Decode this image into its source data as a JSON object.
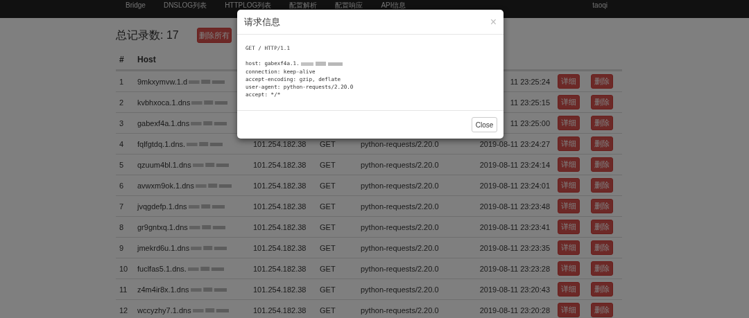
{
  "nav": {
    "items": [
      {
        "label": "Bridge"
      },
      {
        "label": "DNSLOG列表"
      },
      {
        "label": "HTTPLOG列表"
      },
      {
        "label": "配置解析"
      },
      {
        "label": "配置响应"
      },
      {
        "label": "API信息"
      }
    ],
    "user": "taoqi"
  },
  "summary": {
    "title": "总记录数: 17",
    "delete_all": "删除所有"
  },
  "table": {
    "columns": [
      "#",
      "Host"
    ],
    "rows": [
      {
        "index": "1",
        "host": "9mkxymvw.1.d",
        "redacted": true,
        "time": "11 23:25:24",
        "detail": "详细",
        "delete": "删除"
      },
      {
        "index": "2",
        "host": "kvbhxoca.1.dns",
        "redacted": true,
        "time": "11 23:25:15",
        "detail": "详细",
        "delete": "删除"
      },
      {
        "index": "3",
        "host": "gabexf4a.1.dns",
        "redacted": true,
        "time": "11 23:25:00",
        "detail": "详细",
        "delete": "删除"
      },
      {
        "index": "4",
        "host": "fqlfgtdq.1.dns.",
        "redacted": true,
        "ip": "101.254.182.38",
        "method": "GET",
        "agent": "python-requests/2.20.0",
        "time": "2019-08-11 23:24:27",
        "detail": "详细",
        "delete": "删除"
      },
      {
        "index": "5",
        "host": "qzuum4bl.1.dns",
        "redacted": true,
        "ip": "101.254.182.38",
        "method": "GET",
        "agent": "python-requests/2.20.0",
        "time": "2019-08-11 23:24:14",
        "detail": "详细",
        "delete": "删除"
      },
      {
        "index": "6",
        "host": "avwxm9ok.1.dns",
        "redacted": true,
        "ip": "101.254.182.38",
        "method": "GET",
        "agent": "python-requests/2.20.0",
        "time": "2019-08-11 23:24:01",
        "detail": "详细",
        "delete": "删除"
      },
      {
        "index": "7",
        "host": "jvqgdefp.1.dns",
        "redacted": true,
        "ip": "101.254.182.38",
        "method": "GET",
        "agent": "python-requests/2.20.0",
        "time": "2019-08-11 23:23:48",
        "detail": "详细",
        "delete": "删除"
      },
      {
        "index": "8",
        "host": "gr9gntxq.1.dns",
        "redacted": true,
        "ip": "101.254.182.38",
        "method": "GET",
        "agent": "python-requests/2.20.0",
        "time": "2019-08-11 23:23:41",
        "detail": "详细",
        "delete": "删除"
      },
      {
        "index": "9",
        "host": "jmekrd6u.1.dns",
        "redacted": true,
        "ip": "101.254.182.38",
        "method": "GET",
        "agent": "python-requests/2.20.0",
        "time": "2019-08-11 23:23:35",
        "detail": "详细",
        "delete": "删除"
      },
      {
        "index": "10",
        "host": "fuclfas5.1.dns.",
        "redacted": true,
        "ip": "101.254.182.38",
        "method": "GET",
        "agent": "python-requests/2.20.0",
        "time": "2019-08-11 23:23:28",
        "detail": "详细",
        "delete": "删除"
      },
      {
        "index": "11",
        "host": "z4m4ir8x.1.dns",
        "redacted": true,
        "ip": "101.254.182.38",
        "method": "GET",
        "agent": "python-requests/2.20.0",
        "time": "2019-08-11 23:20:43",
        "detail": "详细",
        "delete": "删除"
      },
      {
        "index": "12",
        "host": "wccyzhy7.1.dns",
        "redacted": true,
        "ip": "101.254.182.38",
        "method": "GET",
        "agent": "python-requests/2.20.0",
        "time": "2019-08-11 23:20:28",
        "detail": "详细",
        "delete": "删除"
      }
    ]
  },
  "modal": {
    "title": "请求信息",
    "close_icon": "×",
    "request_line": "GET / HTTP/1.1",
    "headers": [
      {
        "text": "host: gabexf4a.1.",
        "redacted": true
      },
      {
        "text": "connection: keep-alive",
        "redacted": false
      },
      {
        "text": "accept-encoding: gzip, deflate",
        "redacted": false
      },
      {
        "text": "user-agent: python-requests/2.20.0",
        "redacted": false
      },
      {
        "text": "accept: */*",
        "redacted": false
      }
    ],
    "close_button": "Close"
  }
}
